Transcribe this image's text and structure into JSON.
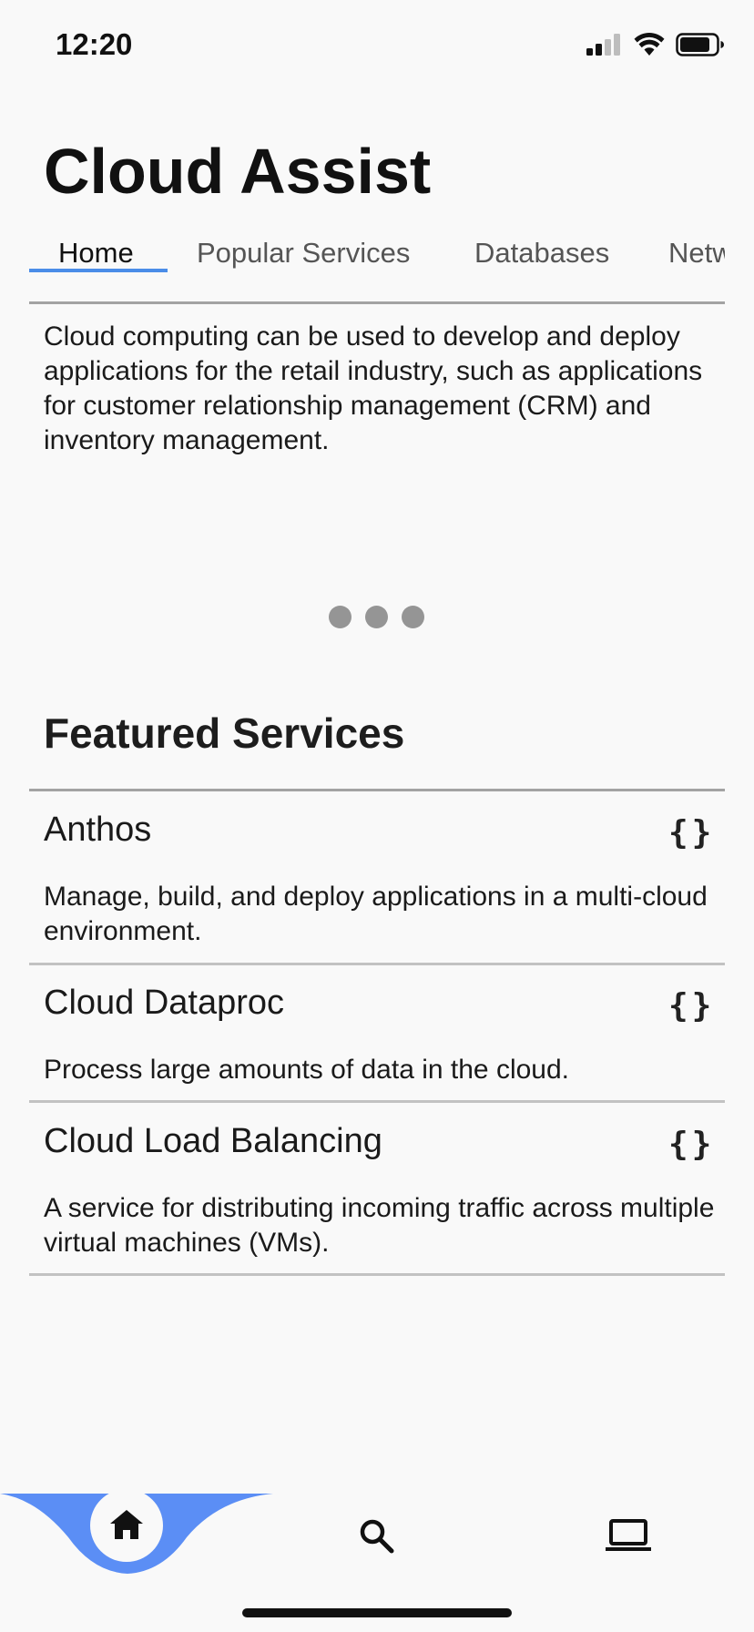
{
  "status_bar": {
    "time": "12:20",
    "icons": [
      "cellular-signal-icon",
      "wifi-icon",
      "battery-icon"
    ]
  },
  "app": {
    "title": "Cloud Assist"
  },
  "tabs": [
    {
      "label": "Home",
      "active": true
    },
    {
      "label": "Popular Services",
      "active": false
    },
    {
      "label": "Databases",
      "active": false
    },
    {
      "label": "Networking",
      "active": false
    }
  ],
  "intro": {
    "text": "Cloud computing can be used to develop and deploy applications for the retail industry, such as applications for customer relationship management (CRM) and inventory management."
  },
  "pager": {
    "dots": 3
  },
  "featured": {
    "title": "Featured Services",
    "items": [
      {
        "name": "Anthos",
        "description": "Manage, build, and deploy applications in a multi-cloud environment.",
        "icon": "code-braces-icon"
      },
      {
        "name": "Cloud Dataproc",
        "description": "Process large amounts of data in the cloud.",
        "icon": "code-braces-icon"
      },
      {
        "name": "Cloud Load Balancing",
        "description": "A service for distributing incoming traffic across multiple virtual machines (VMs).",
        "icon": "code-braces-icon"
      }
    ]
  },
  "bottom_nav": {
    "items": [
      {
        "icon": "home-icon",
        "active": true
      },
      {
        "icon": "search-icon",
        "active": false
      },
      {
        "icon": "laptop-icon",
        "active": false
      }
    ]
  },
  "colors": {
    "accent": "#5b8ef5",
    "tab_indicator": "#4b8de8",
    "background": "#f9f9f9",
    "divider": "#a3a3a3",
    "pager_dot": "#959595"
  }
}
